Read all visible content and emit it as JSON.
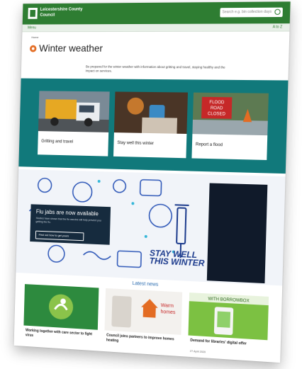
{
  "header": {
    "council_name": "Leicestershire County Council",
    "search_placeholder": "Search e.g. bin collection days",
    "search_icon": "search-icon"
  },
  "nav": {
    "menu_label": "Menu",
    "az_label": "A to Z"
  },
  "breadcrumb": "Home",
  "page": {
    "title": "Winter weather",
    "intro": "Be prepared for the winter weather with information about gritting and travel, staying healthy and the impact on services."
  },
  "cards": [
    {
      "label": "Gritting and travel"
    },
    {
      "label": "Stay well this winter"
    },
    {
      "label": "Report a flood"
    }
  ],
  "flood_sign": {
    "line1": "FLOOD",
    "line2": "ROAD",
    "line3": "CLOSED"
  },
  "promo": {
    "heading": "Flu jabs are now available",
    "body": "Studies have shown that the flu vaccine will help prevent you getting the flu.",
    "cta": "Find out how to get yours",
    "slogan_line1": "STAY WELL",
    "slogan_line2": "THIS WINTER"
  },
  "latest_news": {
    "heading": "Latest news",
    "items": [
      {
        "title": "Working together with care sector to fight virus",
        "date": ""
      },
      {
        "title": "Council joins partners to improve homes heating",
        "date": "",
        "badge_line1": "Warm",
        "badge_line2": "homes"
      },
      {
        "title": "Demand for libraries' digital offer",
        "date": "27 April 2020",
        "banner": "WITH BORROWBOX"
      }
    ]
  },
  "colors": {
    "header_green": "#2e7d32",
    "teal_band": "#11797b",
    "promo_navy": "#162b3e",
    "accent_orange": "#e36c23"
  }
}
